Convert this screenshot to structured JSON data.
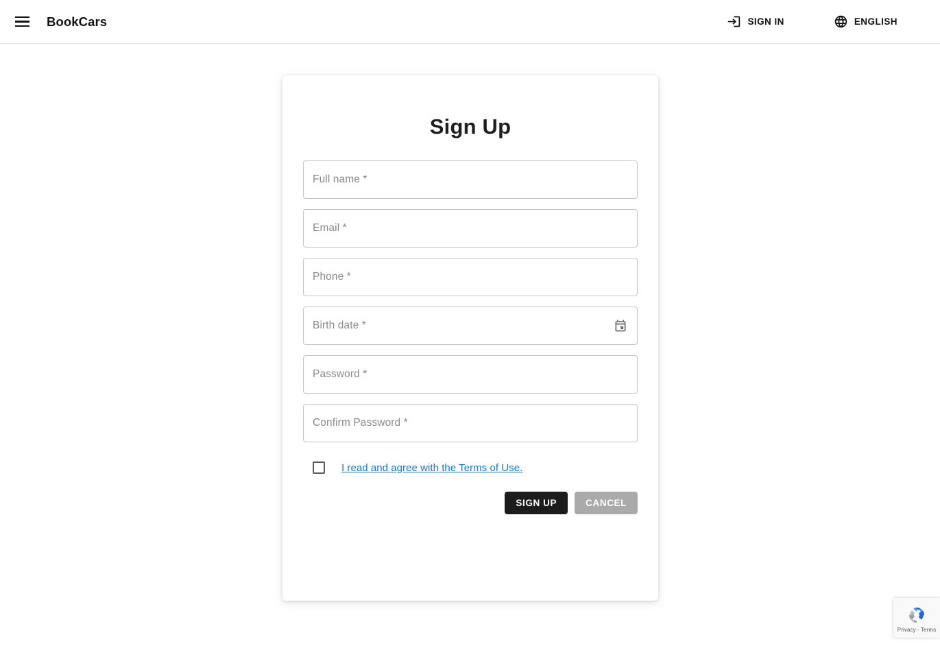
{
  "header": {
    "menu_icon": "hamburger-menu-icon",
    "brand": "BookCars",
    "actions": [
      {
        "icon": "login-icon",
        "label": "SIGN IN"
      },
      {
        "icon": "globe-icon",
        "label": "ENGLISH"
      }
    ]
  },
  "signup": {
    "title": "Sign Up",
    "fields": [
      {
        "name": "full-name",
        "placeholder": "Full name *",
        "value": "",
        "type": "text",
        "adornment": null
      },
      {
        "name": "email",
        "placeholder": "Email *",
        "value": "",
        "type": "text",
        "adornment": null
      },
      {
        "name": "phone",
        "placeholder": "Phone *",
        "value": "",
        "type": "text",
        "adornment": null
      },
      {
        "name": "birth-date",
        "placeholder": "Birth date *",
        "value": "",
        "type": "text",
        "adornment": "calendar-icon"
      },
      {
        "name": "password",
        "placeholder": "Password *",
        "value": "",
        "type": "password",
        "adornment": null
      },
      {
        "name": "confirm-password",
        "placeholder": "Confirm Password *",
        "value": "",
        "type": "password",
        "adornment": null
      }
    ],
    "terms": {
      "checked": false,
      "link_text": "I read and agree with the Terms of Use."
    },
    "buttons": {
      "submit": "SIGN UP",
      "cancel": "CANCEL"
    }
  },
  "recaptcha": {
    "text": "Privacy - Terms",
    "logo": "recaptcha-logo-icon"
  },
  "colors": {
    "accent_link": "#1976d2",
    "primary_button": "#1c1c1c",
    "secondary_button": "#aaaaaa",
    "field_border": "#c4c4c4",
    "placeholder_text": "#8a8a8a",
    "page_background": "#ffffff"
  }
}
